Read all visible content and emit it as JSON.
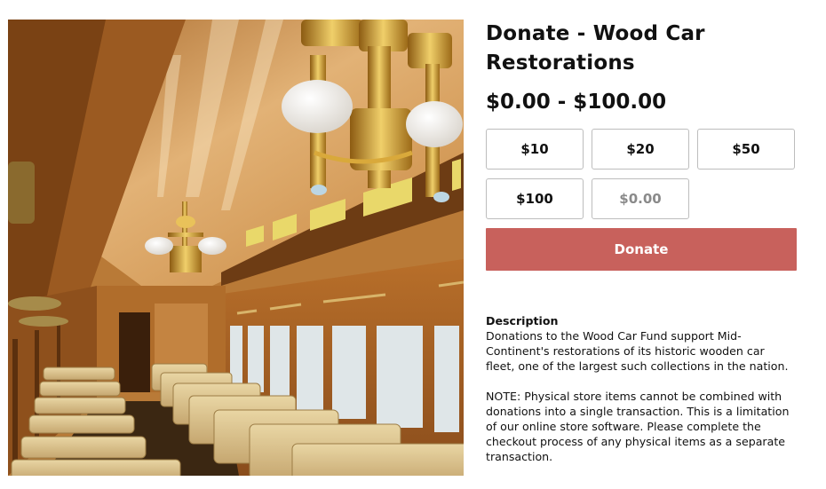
{
  "product": {
    "image_alt": "Interior of restored wooden passenger car with wicker seats and brass chandeliers",
    "title": "Donate - Wood Car Restorations",
    "price_range": "$0.00 - $100.00"
  },
  "amount_options": [
    "$10",
    "$20",
    "$50",
    "$100"
  ],
  "custom_amount": {
    "placeholder": "$0.00",
    "value": ""
  },
  "donate_button": "Donate",
  "description": {
    "heading": "Description",
    "paragraphs": [
      "Donations to the Wood Car Fund support Mid-Continent's restorations of its historic wooden car fleet, one of the largest such collections in the nation.",
      "NOTE: Physical store items cannot be combined with donations into a single transaction. This is a limitation of our online store software. Please complete the checkout process of any physical items as a separate transaction."
    ]
  },
  "colors": {
    "donate_button": "#c8615c",
    "button_border": "#bdbdbd",
    "text": "#111111"
  }
}
